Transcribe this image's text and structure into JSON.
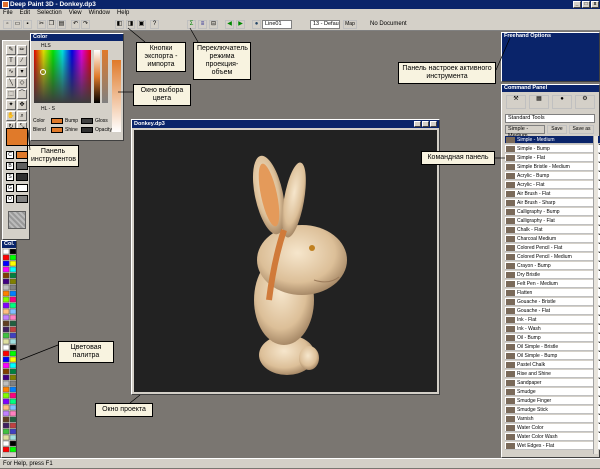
{
  "app": {
    "title": "Deep Paint 3D - Donkey.dp3",
    "menu": [
      "File",
      "Edit",
      "Selection",
      "View",
      "Window",
      "Help"
    ],
    "toolbar": {
      "layer_select": "Line01",
      "size_select": "13 - Defau",
      "map_button": "Map",
      "doc_status": "No Document"
    },
    "status_text": "For Help, press F1"
  },
  "color_panel": {
    "title": "Color",
    "mode_label": "HLS",
    "slider_label": "HL - S",
    "rows": [
      {
        "label": "Color",
        "mid": "Bump",
        "right": "Gloss"
      },
      {
        "label": "Blend",
        "mid": "Shine",
        "right": "Opacity"
      }
    ]
  },
  "palette_panel": {
    "title": "Col."
  },
  "project_window": {
    "title": "Donkey.dp3"
  },
  "freehand_panel": {
    "title": "Freehand Options"
  },
  "command_panel": {
    "title": "Command Panel",
    "toolset": "Standard Tools",
    "current": "Simple - Medium",
    "save_button": "Save",
    "save_as_button": "Save as",
    "items": [
      "Simple - Medium",
      "Simple - Bump",
      "Simple - Flat",
      "Simple Bristle - Medium",
      "Acrylic - Bump",
      "Acrylic - Flat",
      "Air Brush - Flat",
      "Air Brush - Sharp",
      "Calligraphy - Bump",
      "Calligraphy - Flat",
      "Chalk - Flat",
      "Charcoal Medium",
      "Colored Pencil - Flat",
      "Colored Pencil - Medium",
      "Crayon - Bump",
      "Dry Bristle",
      "Felt Pen - Medium",
      "Flatten",
      "Gouache - Bristle",
      "Gouache - Flat",
      "Ink - Flat",
      "Ink - Wash",
      "Oil - Bump",
      "Oil Simple - Bristle",
      "Oil Simple - Bump",
      "Pastel Chalk",
      "Rise and Shine",
      "Sandpaper",
      "Smudge",
      "Smudge Finger",
      "Smudge Stick",
      "Varnish",
      "Water Color",
      "Water Color Wash",
      "Wet Edges - Flat"
    ]
  },
  "callouts": {
    "export_import": "Кнопки экспорта - импорта",
    "mode_switch": "Переключатель режима проекция-объем",
    "tool_settings": "Панель настроек активного инструмента",
    "color_picker": "Окно выбора цвета",
    "tools_panel": "Панель инструментов",
    "command_panel": "Командная панель",
    "palette": "Цветовая палитра",
    "project_window": "Окно проекта"
  },
  "colors": {
    "workspace": "#7a7671",
    "title_blue": "#0a246a",
    "chrome": "#d4d0c8",
    "paint_orange": "#e07a2a",
    "canvas_dark": "#222222"
  }
}
